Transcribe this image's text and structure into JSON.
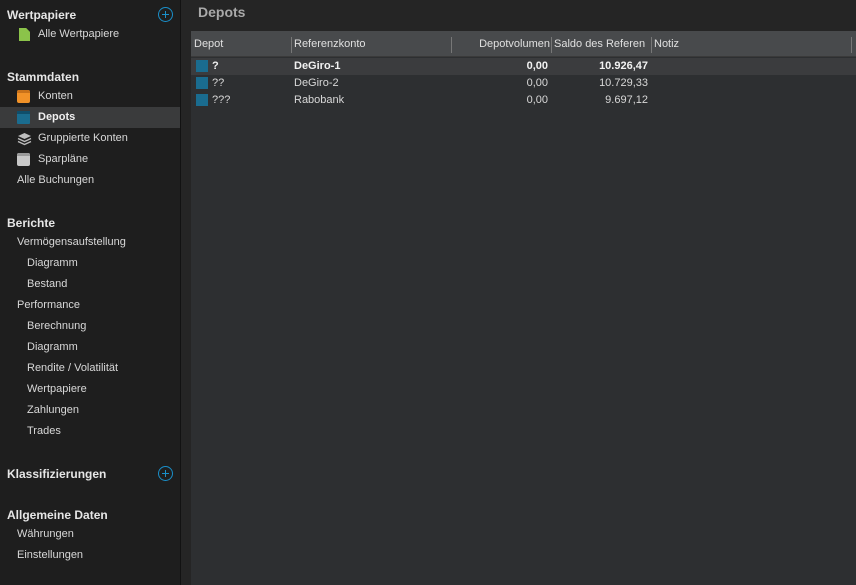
{
  "sidebar": {
    "sections": [
      {
        "title": "Wertpapiere",
        "has_add": true
      },
      {
        "title": "Stammdaten",
        "has_add": false
      },
      {
        "title": "Berichte",
        "has_add": false
      },
      {
        "title": "Klassifizierungen",
        "has_add": true
      },
      {
        "title": "Allgemeine Daten",
        "has_add": false
      }
    ],
    "items": [
      {
        "label": "Alle Wertpapiere",
        "icon": "document-icon"
      },
      {
        "label": "Konten",
        "icon": "account-icon"
      },
      {
        "label": "Depots",
        "icon": "depot-icon",
        "selected": true
      },
      {
        "label": "Gruppierte Konten",
        "icon": "layers-icon"
      },
      {
        "label": "Sparpläne",
        "icon": "savings-plan-icon"
      },
      {
        "label": "Alle Buchungen"
      },
      {
        "label": "Vermögensaufstellung"
      },
      {
        "label": "Diagramm"
      },
      {
        "label": "Bestand"
      },
      {
        "label": "Performance"
      },
      {
        "label": "Berechnung"
      },
      {
        "label": "Diagramm"
      },
      {
        "label": "Rendite / Volatilität"
      },
      {
        "label": "Wertpapiere"
      },
      {
        "label": "Zahlungen"
      },
      {
        "label": "Trades"
      },
      {
        "label": "Währungen"
      },
      {
        "label": "Einstellungen"
      }
    ]
  },
  "main": {
    "title": "Depots",
    "columns": [
      "Depot",
      "Referenzkonto",
      "Depotvolumen",
      "Saldo des Referen",
      "Notiz"
    ],
    "rows": [
      {
        "depot": "?",
        "referenzkonto": "DeGiro-1",
        "depotvolumen": "0,00",
        "saldo": "10.926,47",
        "notiz": "",
        "selected": true
      },
      {
        "depot": "??",
        "referenzkonto": "DeGiro-2",
        "depotvolumen": "0,00",
        "saldo": "10.729,33",
        "notiz": ""
      },
      {
        "depot": "???",
        "referenzkonto": "Rabobank",
        "depotvolumen": "0,00",
        "saldo": "9.697,12",
        "notiz": ""
      }
    ]
  },
  "colors": {
    "accent": "#1a8fc9",
    "depot_icon": "#1a6c8f",
    "account_icon": "#f19228",
    "document_icon": "#8bc34a"
  }
}
